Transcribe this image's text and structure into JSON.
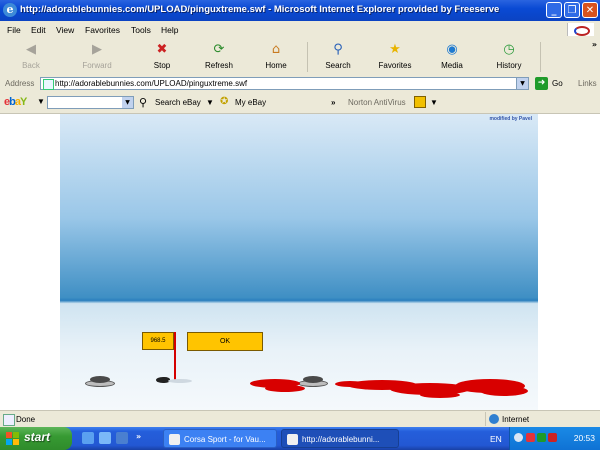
{
  "window": {
    "title": "http://adorablebunnies.com/UPLOAD/pinguxtreme.swf - Microsoft Internet Explorer provided by Freeserve",
    "minimize": "_",
    "maximize": "❐",
    "close": "✕"
  },
  "menu": {
    "items": [
      "File",
      "Edit",
      "View",
      "Favorites",
      "Tools",
      "Help"
    ]
  },
  "toolbar": {
    "back": "Back",
    "forward": "Forward",
    "stop": "Stop",
    "refresh": "Refresh",
    "home": "Home",
    "search": "Search",
    "favorites": "Favorites",
    "media": "Media",
    "history": "History",
    "overflow": "»"
  },
  "address": {
    "label": "Address",
    "url": "http://adorablebunnies.com/UPLOAD/pinguxtreme.swf",
    "go": "Go",
    "links": "Links"
  },
  "ebay": {
    "search_label": "Search eBay",
    "my_ebay": "My eBay",
    "overflow": "»",
    "norton": "Norton AntiVirus"
  },
  "game": {
    "credit": "modified by Pavel",
    "score": "968.5",
    "ok": "OK"
  },
  "status": {
    "text": "Done",
    "zone": "Internet"
  },
  "taskbar": {
    "start": "start",
    "tasks": [
      {
        "label": "Corsa Sport - for Vau..."
      },
      {
        "label": "http://adorablebunni..."
      }
    ],
    "language": "EN",
    "clock": "20:53"
  },
  "colors": {
    "xp_blue": "#0a4ad4",
    "start_green": "#379a33",
    "game_button": "#ffc400",
    "blood": "#d80000"
  }
}
